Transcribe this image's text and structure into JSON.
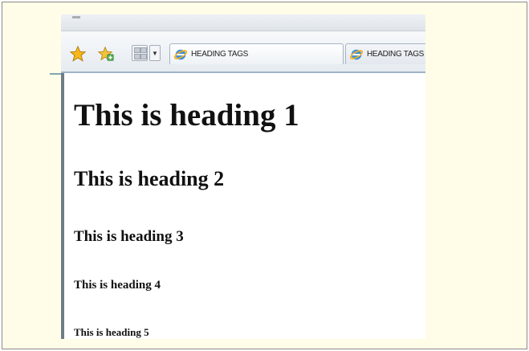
{
  "browser": {
    "toolbar": {
      "favorites_icon": "favorites-star-icon",
      "add_favorites_icon": "add-favorites-icon",
      "quick_tabs_icon": "quick-tabs-icon",
      "tab_list_icon": "tab-list-dropdown-icon"
    },
    "tabs": [
      {
        "label": "HEADING TAGS",
        "icon": "ie-page-icon",
        "active": true
      },
      {
        "label": "HEADING TAGS",
        "icon": "ie-page-icon",
        "active": false
      }
    ]
  },
  "page": {
    "headings": [
      "This is heading 1",
      "This is heading 2",
      "This is heading 3",
      "This is heading 4",
      "This is heading 5"
    ]
  },
  "colors": {
    "frame_background": "#fffde7",
    "toolbar_border": "#9fb3c8",
    "content_left_border": "#6f7c88"
  }
}
